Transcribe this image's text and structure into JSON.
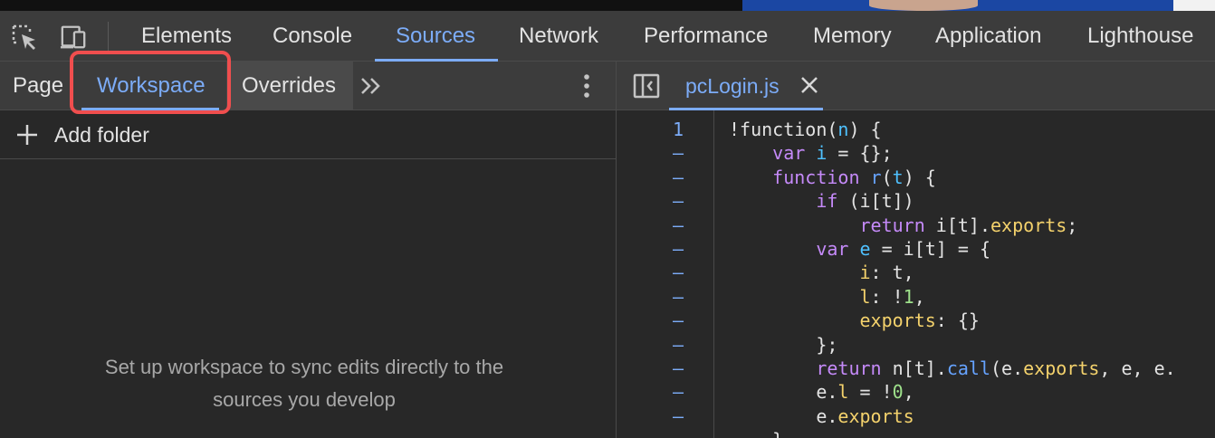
{
  "toolbar": {
    "tabs": [
      {
        "label": "Elements",
        "active": false
      },
      {
        "label": "Console",
        "active": false
      },
      {
        "label": "Sources",
        "active": true
      },
      {
        "label": "Network",
        "active": false
      },
      {
        "label": "Performance",
        "active": false
      },
      {
        "label": "Memory",
        "active": false
      },
      {
        "label": "Application",
        "active": false
      },
      {
        "label": "Lighthouse",
        "active": false
      }
    ],
    "icons": [
      "inspect-element-icon",
      "device-toolbar-icon"
    ]
  },
  "navigator": {
    "tabs": [
      {
        "label": "Page",
        "active": false
      },
      {
        "label": "Workspace",
        "active": true
      },
      {
        "label": "Overrides",
        "active": false
      }
    ],
    "more_icon": "chevron-double-right-icon",
    "menu_icon": "kebab-menu-icon",
    "add_folder_label": "Add folder",
    "empty_message_line1": "Set up workspace to sync edits directly to the",
    "empty_message_line2": "sources you develop"
  },
  "editor": {
    "file_name": "pcLogin.js",
    "close_icon": "close-icon",
    "toggle_icon": "toggle-navigator-icon",
    "line_markers": [
      "1",
      "–",
      "–",
      "–",
      "–",
      "–",
      "–",
      "–",
      "–",
      "–",
      "–",
      "–",
      "–",
      "–"
    ],
    "code_lines": [
      [
        {
          "t": "!function(",
          "c": "pl"
        },
        {
          "t": "n",
          "c": "vr"
        },
        {
          "t": ") {",
          "c": "pl"
        }
      ],
      [
        {
          "t": "    ",
          "c": "pl"
        },
        {
          "t": "var",
          "c": "kw"
        },
        {
          "t": " ",
          "c": "pl"
        },
        {
          "t": "i",
          "c": "vr"
        },
        {
          "t": " = {};",
          "c": "pl"
        }
      ],
      [
        {
          "t": "    ",
          "c": "pl"
        },
        {
          "t": "function",
          "c": "kw"
        },
        {
          "t": " ",
          "c": "pl"
        },
        {
          "t": "r",
          "c": "fn"
        },
        {
          "t": "(",
          "c": "pl"
        },
        {
          "t": "t",
          "c": "vr"
        },
        {
          "t": ") {",
          "c": "pl"
        }
      ],
      [
        {
          "t": "        ",
          "c": "pl"
        },
        {
          "t": "if",
          "c": "kw"
        },
        {
          "t": " (i[t])",
          "c": "pl"
        }
      ],
      [
        {
          "t": "            ",
          "c": "pl"
        },
        {
          "t": "return",
          "c": "kw"
        },
        {
          "t": " i[t].",
          "c": "pl"
        },
        {
          "t": "exports",
          "c": "pr"
        },
        {
          "t": ";",
          "c": "pl"
        }
      ],
      [
        {
          "t": "        ",
          "c": "pl"
        },
        {
          "t": "var",
          "c": "kw"
        },
        {
          "t": " ",
          "c": "pl"
        },
        {
          "t": "e",
          "c": "vr"
        },
        {
          "t": " = i[t] = {",
          "c": "pl"
        }
      ],
      [
        {
          "t": "            ",
          "c": "pl"
        },
        {
          "t": "i",
          "c": "pr"
        },
        {
          "t": ": t,",
          "c": "pl"
        }
      ],
      [
        {
          "t": "            ",
          "c": "pl"
        },
        {
          "t": "l",
          "c": "pr"
        },
        {
          "t": ": !",
          "c": "pl"
        },
        {
          "t": "1",
          "c": "nm"
        },
        {
          "t": ",",
          "c": "pl"
        }
      ],
      [
        {
          "t": "            ",
          "c": "pl"
        },
        {
          "t": "exports",
          "c": "pr"
        },
        {
          "t": ": {}",
          "c": "pl"
        }
      ],
      [
        {
          "t": "        };",
          "c": "pl"
        }
      ],
      [
        {
          "t": "        ",
          "c": "pl"
        },
        {
          "t": "return",
          "c": "kw"
        },
        {
          "t": " n[t].",
          "c": "pl"
        },
        {
          "t": "call",
          "c": "fn"
        },
        {
          "t": "(e.",
          "c": "pl"
        },
        {
          "t": "exports",
          "c": "pr"
        },
        {
          "t": ", e, e.",
          "c": "pl"
        }
      ],
      [
        {
          "t": "        e.",
          "c": "pl"
        },
        {
          "t": "l",
          "c": "pr"
        },
        {
          "t": " = !",
          "c": "pl"
        },
        {
          "t": "0",
          "c": "nm"
        },
        {
          "t": ",",
          "c": "pl"
        }
      ],
      [
        {
          "t": "        e.",
          "c": "pl"
        },
        {
          "t": "exports",
          "c": "pr"
        }
      ],
      [
        {
          "t": "    }",
          "c": "pl"
        }
      ]
    ]
  },
  "colors": {
    "accent": "#7cacf8",
    "highlight": "#f04e4e",
    "panel_bg": "#282828",
    "toolbar_bg": "#3c3c3c"
  }
}
